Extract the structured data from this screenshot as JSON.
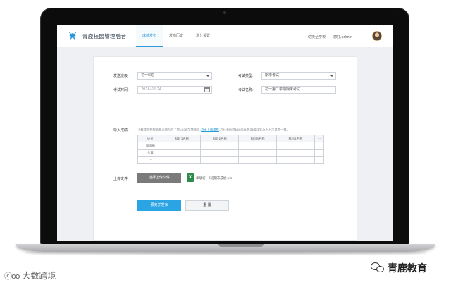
{
  "app": {
    "title": "青鹿校园管理后台"
  },
  "nav": [
    {
      "label": "成绩发布",
      "active": true
    },
    {
      "label": "发布历史",
      "active": false
    },
    {
      "label": "满分设置",
      "active": false
    }
  ],
  "header": {
    "switch_school": "切换至学校",
    "greeting": "您好,admin"
  },
  "form": {
    "send_to_label": "发送班级:",
    "send_to_value": "初一6班",
    "exam_type_label": "考试类型:",
    "exam_type_value": "期末考试",
    "exam_time_label": "考试时间:",
    "exam_time_value": "2016-02-24",
    "exam_name_label": "考试名称:",
    "exam_name_value": "初一第二学期期末考试",
    "import_label": "导入成绩:",
    "hint_prefix": "下载模板并根据要求填写后上传Excel文件即可,",
    "hint_link": "点击下载模板",
    "hint_suffix": ",若已有成绩Excel表格,编辑样式与下方示意图一致。",
    "upload_label": "上传文件:",
    "upload_button": "选择上传文件",
    "file_icon_text": "X",
    "file_name": "年级初一6班期末成绩.xls",
    "submit_button": "预览并发布",
    "reset_button": "重 置"
  },
  "table": {
    "headers": [
      "姓名",
      "科目1名称",
      "科目2名称",
      "科目3名称",
      "科目4名称",
      "..."
    ],
    "rows": [
      [
        "和雨梅",
        "",
        "",
        "",
        "",
        ""
      ],
      [
        "金蕾",
        "",
        "",
        "",
        "",
        ""
      ],
      [
        "...",
        "",
        "",
        "",
        "",
        ""
      ]
    ]
  },
  "watermarks": {
    "left_logo": "ⓒoo",
    "left_text": "大数跨境",
    "right_text": "青鹿教育"
  },
  "colors": {
    "accent": "#2ba4e4",
    "nav_active": "#2a9ad6",
    "excel_green": "#2e8b4e"
  }
}
